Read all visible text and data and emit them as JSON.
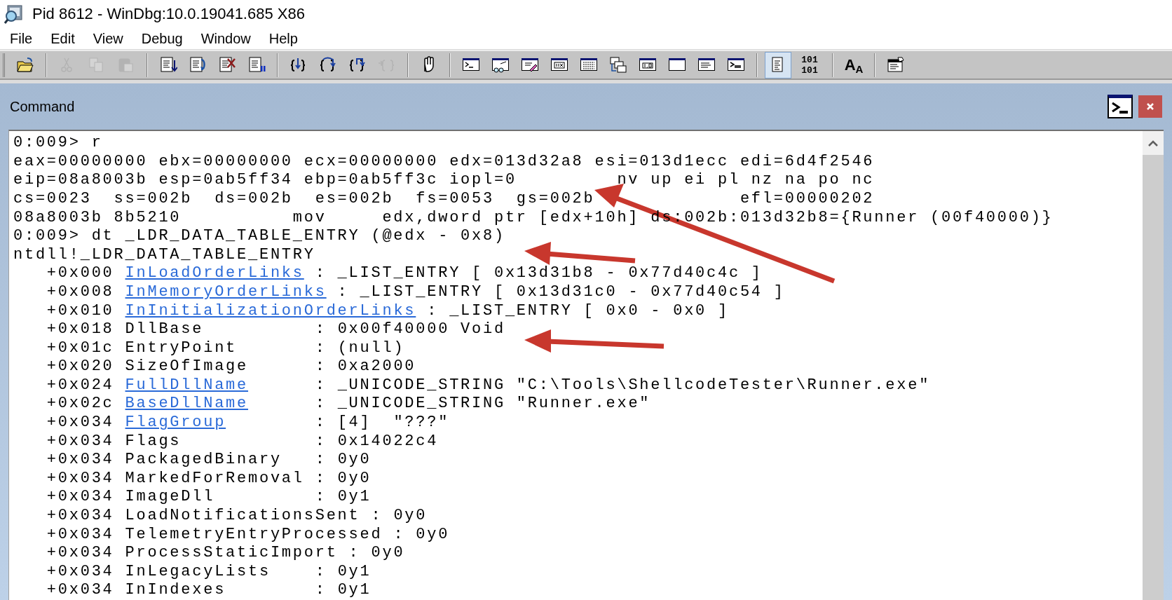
{
  "window": {
    "title": "Pid 8612 - WinDbg:10.0.19041.685 X86"
  },
  "menu": [
    "File",
    "Edit",
    "View",
    "Debug",
    "Window",
    "Help"
  ],
  "toolbar": {
    "groups": [
      [
        {
          "kind": "open",
          "disabled": false,
          "pressed": false
        }
      ],
      [
        {
          "kind": "cut",
          "disabled": true,
          "pressed": false
        },
        {
          "kind": "copy",
          "disabled": true,
          "pressed": false
        },
        {
          "kind": "paste",
          "disabled": true,
          "pressed": false
        }
      ],
      [
        {
          "kind": "go",
          "disabled": false,
          "pressed": false
        },
        {
          "kind": "restart",
          "disabled": false,
          "pressed": false
        },
        {
          "kind": "stop",
          "disabled": false,
          "pressed": false
        },
        {
          "kind": "break",
          "disabled": false,
          "pressed": false
        }
      ],
      [
        {
          "kind": "step-into",
          "disabled": false,
          "pressed": false
        },
        {
          "kind": "step-over",
          "disabled": false,
          "pressed": false
        },
        {
          "kind": "step-out",
          "disabled": false,
          "pressed": false
        },
        {
          "kind": "run-to-cursor",
          "disabled": true,
          "pressed": false
        }
      ],
      [
        {
          "kind": "breakpoint",
          "disabled": false,
          "pressed": false
        }
      ],
      [
        {
          "kind": "command",
          "disabled": false,
          "pressed": false
        },
        {
          "kind": "watch",
          "disabled": false,
          "pressed": false
        },
        {
          "kind": "locals",
          "disabled": false,
          "pressed": false
        },
        {
          "kind": "registers",
          "disabled": false,
          "pressed": false
        },
        {
          "kind": "memory",
          "disabled": false,
          "pressed": false
        },
        {
          "kind": "call-stack",
          "disabled": false,
          "pressed": false
        },
        {
          "kind": "disassembly",
          "disabled": false,
          "pressed": false
        },
        {
          "kind": "scratch-pad",
          "disabled": false,
          "pressed": false
        },
        {
          "kind": "processes",
          "disabled": false,
          "pressed": false
        },
        {
          "kind": "command-browser",
          "disabled": false,
          "pressed": false
        }
      ],
      [
        {
          "kind": "source-mode",
          "disabled": false,
          "pressed": true
        },
        {
          "kind": "assembly-mode",
          "label": "101 101",
          "disabled": false,
          "pressed": false
        }
      ],
      [
        {
          "kind": "font",
          "label": "A$_{A}$",
          "disabled": false,
          "pressed": false
        }
      ],
      [
        {
          "kind": "options",
          "disabled": false,
          "pressed": false
        }
      ]
    ]
  },
  "pane": {
    "title": "Command"
  },
  "console": {
    "lines": [
      {
        "kind": "text",
        "text": "0:009> r"
      },
      {
        "kind": "text",
        "text": "eax=00000000 ebx=00000000 ecx=00000000 edx=013d32a8 esi=013d1ecc edi=6d4f2546"
      },
      {
        "kind": "text",
        "text": "eip=08a8003b esp=0ab5ff34 ebp=0ab5ff3c iopl=0         nv up ei pl nz na po nc"
      },
      {
        "kind": "text",
        "text": "cs=0023  ss=002b  ds=002b  es=002b  fs=0053  gs=002b             efl=00000202"
      },
      {
        "kind": "text",
        "text": "08a8003b 8b5210          mov     edx,dword ptr [edx+10h] ds:002b:013d32b8={Runner (00f40000)}"
      },
      {
        "kind": "text",
        "text": "0:009> dt _LDR_DATA_TABLE_ENTRY (@edx - 0x8)"
      },
      {
        "kind": "text",
        "text": "ntdll!_LDR_DATA_TABLE_ENTRY"
      },
      {
        "kind": "field",
        "offset": "+0x000",
        "name": "InLoadOrderLinks",
        "link": true,
        "value": ": _LIST_ENTRY [ 0x13d31b8 - 0x77d40c4c ]"
      },
      {
        "kind": "field",
        "offset": "+0x008",
        "name": "InMemoryOrderLinks",
        "link": true,
        "value": ": _LIST_ENTRY [ 0x13d31c0 - 0x77d40c54 ]"
      },
      {
        "kind": "field",
        "offset": "+0x010",
        "name": "InInitializationOrderLinks",
        "link": true,
        "value": ": _LIST_ENTRY [ 0x0 - 0x0 ]"
      },
      {
        "kind": "field",
        "offset": "+0x018",
        "name": "DllBase",
        "link": false,
        "value": ": 0x00f40000 Void"
      },
      {
        "kind": "field",
        "offset": "+0x01c",
        "name": "EntryPoint",
        "link": false,
        "value": ": (null)"
      },
      {
        "kind": "field",
        "offset": "+0x020",
        "name": "SizeOfImage",
        "link": false,
        "value": ": 0xa2000"
      },
      {
        "kind": "field",
        "offset": "+0x024",
        "name": "FullDllName",
        "link": true,
        "value": ": _UNICODE_STRING \"C:\\Tools\\ShellcodeTester\\Runner.exe\""
      },
      {
        "kind": "field",
        "offset": "+0x02c",
        "name": "BaseDllName",
        "link": true,
        "value": ": _UNICODE_STRING \"Runner.exe\""
      },
      {
        "kind": "field",
        "offset": "+0x034",
        "name": "FlagGroup",
        "link": true,
        "value": ": [4]  \"???\""
      },
      {
        "kind": "field",
        "offset": "+0x034",
        "name": "Flags",
        "link": false,
        "value": ": 0x14022c4"
      },
      {
        "kind": "field",
        "offset": "+0x034",
        "name": "PackagedBinary",
        "link": false,
        "value": ": 0y0"
      },
      {
        "kind": "field",
        "offset": "+0x034",
        "name": "MarkedForRemoval",
        "link": false,
        "value": ": 0y0"
      },
      {
        "kind": "field",
        "offset": "+0x034",
        "name": "ImageDll",
        "link": false,
        "value": ": 0y1"
      },
      {
        "kind": "field",
        "offset": "+0x034",
        "name": "LoadNotificationsSent",
        "link": false,
        "value": ": 0y0"
      },
      {
        "kind": "field",
        "offset": "+0x034",
        "name": "TelemetryEntryProcessed",
        "link": false,
        "value": ": 0y0"
      },
      {
        "kind": "field",
        "offset": "+0x034",
        "name": "ProcessStaticImport",
        "link": false,
        "value": ": 0y0"
      },
      {
        "kind": "field",
        "offset": "+0x034",
        "name": "InLegacyLists",
        "link": false,
        "value": ": 0y1"
      },
      {
        "kind": "field",
        "offset": "+0x034",
        "name": "InIndexes",
        "link": false,
        "value": ": 0y1"
      }
    ]
  }
}
